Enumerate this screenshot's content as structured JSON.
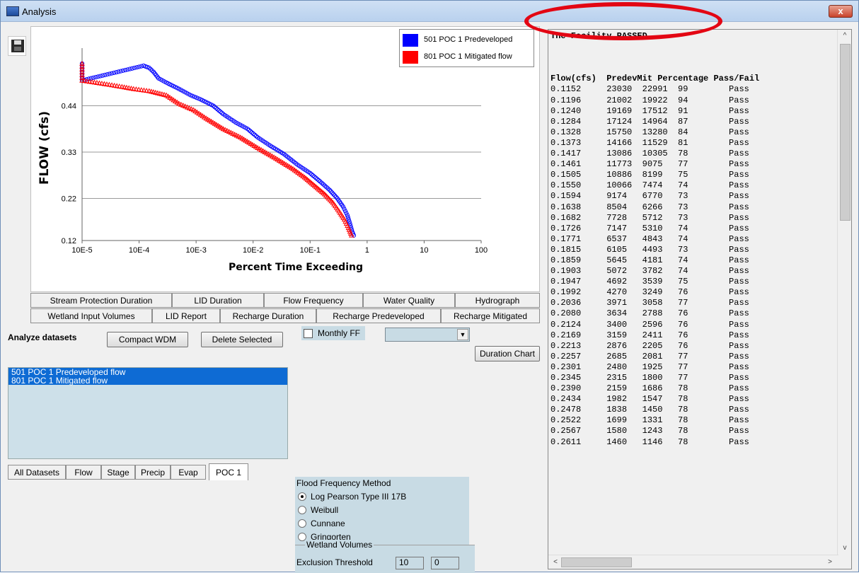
{
  "window": {
    "title": "Analysis",
    "close_label": "x"
  },
  "legend": [
    {
      "label": "501 POC 1 Predeveloped",
      "color": "#0000ff"
    },
    {
      "label": "801 POC 1 Mitigated flow",
      "color": "#ff0000"
    }
  ],
  "chart_data": {
    "type": "scatter",
    "title": "",
    "ylabel": "FLOW (cfs)",
    "xlabel": "Percent Time Exceeding",
    "x_scale": "log",
    "x_ticks": [
      "10E-5",
      "10E-4",
      "10E-3",
      "10E-2",
      "10E-1",
      "1",
      "10",
      "100"
    ],
    "y_ticks": [
      "0.12",
      "0.22",
      "0.33",
      "0.44"
    ],
    "ylim": [
      0.12,
      0.56
    ],
    "grid": "horizontal",
    "series": [
      {
        "name": "501 POC 1 Predeveloped",
        "color": "#0000ff",
        "marker": "circle",
        "points": [
          [
            1e-05,
            0.54
          ],
          [
            1e-05,
            0.52
          ],
          [
            1e-05,
            0.5
          ],
          [
            0.00012,
            0.535
          ],
          [
            0.00015,
            0.53
          ],
          [
            0.00018,
            0.52
          ],
          [
            0.00022,
            0.505
          ],
          [
            0.0003,
            0.495
          ],
          [
            0.0005,
            0.48
          ],
          [
            0.0008,
            0.465
          ],
          [
            0.0012,
            0.455
          ],
          [
            0.002,
            0.44
          ],
          [
            0.003,
            0.42
          ],
          [
            0.005,
            0.4
          ],
          [
            0.008,
            0.385
          ],
          [
            0.012,
            0.365
          ],
          [
            0.02,
            0.345
          ],
          [
            0.035,
            0.325
          ],
          [
            0.06,
            0.3
          ],
          [
            0.1,
            0.28
          ],
          [
            0.15,
            0.26
          ],
          [
            0.22,
            0.24
          ],
          [
            0.3,
            0.22
          ],
          [
            0.38,
            0.2
          ],
          [
            0.45,
            0.18
          ],
          [
            0.5,
            0.16
          ],
          [
            0.55,
            0.14
          ],
          [
            0.6,
            0.128
          ]
        ]
      },
      {
        "name": "801 POC 1 Mitigated flow",
        "color": "#ff0000",
        "marker": "triangle",
        "points": [
          [
            1e-05,
            0.54
          ],
          [
            1e-05,
            0.52
          ],
          [
            1e-05,
            0.5
          ],
          [
            3e-05,
            0.49
          ],
          [
            5e-05,
            0.485
          ],
          [
            8e-05,
            0.48
          ],
          [
            0.00015,
            0.475
          ],
          [
            0.0003,
            0.465
          ],
          [
            0.0005,
            0.445
          ],
          [
            0.0009,
            0.43
          ],
          [
            0.0015,
            0.41
          ],
          [
            0.003,
            0.385
          ],
          [
            0.006,
            0.365
          ],
          [
            0.012,
            0.34
          ],
          [
            0.025,
            0.315
          ],
          [
            0.05,
            0.29
          ],
          [
            0.08,
            0.27
          ],
          [
            0.12,
            0.25
          ],
          [
            0.18,
            0.23
          ],
          [
            0.25,
            0.21
          ],
          [
            0.32,
            0.19
          ],
          [
            0.4,
            0.17
          ],
          [
            0.47,
            0.15
          ],
          [
            0.55,
            0.128
          ]
        ]
      }
    ]
  },
  "tabs_row1": [
    "Stream Protection Duration",
    "LID Duration",
    "Flow Frequency",
    "Water Quality",
    "Hydrograph"
  ],
  "tabs_row2": [
    "Wetland Input Volumes",
    "LID Report",
    "Recharge Duration",
    "Recharge Predeveloped",
    "Recharge Mitigated"
  ],
  "analyze": {
    "label": "Analyze datasets",
    "compact": "Compact WDM",
    "delete": "Delete Selected"
  },
  "monthly_ff": "Monthly FF",
  "duration_chart": "Duration Chart",
  "datasets": [
    "501 POC 1 Predeveloped flow",
    "801 POC 1 Mitigated flow"
  ],
  "dataset_tabs": [
    "All Datasets",
    "Flow",
    "Stage",
    "Precip",
    "Evap",
    "POC 1"
  ],
  "flood_freq": {
    "title": "Flood Frequency Method",
    "options": [
      "Log Pearson Type III 17B",
      "Weibull",
      "Cunnane",
      "Gringorten"
    ],
    "selected": "Log Pearson Type III 17B"
  },
  "wetland": {
    "legend": "Wetland Volumes",
    "exclusion_label": "Exclusion Threshold",
    "value1": "10",
    "value2": "0"
  },
  "results": {
    "status": "The Facility PASSED",
    "header": [
      "Flow(cfs)",
      "Predev",
      "Mit",
      "Percentage",
      "Pass/Fail"
    ],
    "rows": [
      [
        "0.1152",
        "23030",
        "22991",
        "99",
        "Pass"
      ],
      [
        "0.1196",
        "21002",
        "19922",
        "94",
        "Pass"
      ],
      [
        "0.1240",
        "19169",
        "17512",
        "91",
        "Pass"
      ],
      [
        "0.1284",
        "17124",
        "14964",
        "87",
        "Pass"
      ],
      [
        "0.1328",
        "15750",
        "13280",
        "84",
        "Pass"
      ],
      [
        "0.1373",
        "14166",
        "11529",
        "81",
        "Pass"
      ],
      [
        "0.1417",
        "13086",
        "10305",
        "78",
        "Pass"
      ],
      [
        "0.1461",
        "11773",
        "9075",
        "77",
        "Pass"
      ],
      [
        "0.1505",
        "10886",
        "8199",
        "75",
        "Pass"
      ],
      [
        "0.1550",
        "10066",
        "7474",
        "74",
        "Pass"
      ],
      [
        "0.1594",
        "9174",
        "6770",
        "73",
        "Pass"
      ],
      [
        "0.1638",
        "8504",
        "6266",
        "73",
        "Pass"
      ],
      [
        "0.1682",
        "7728",
        "5712",
        "73",
        "Pass"
      ],
      [
        "0.1726",
        "7147",
        "5310",
        "74",
        "Pass"
      ],
      [
        "0.1771",
        "6537",
        "4843",
        "74",
        "Pass"
      ],
      [
        "0.1815",
        "6105",
        "4493",
        "73",
        "Pass"
      ],
      [
        "0.1859",
        "5645",
        "4181",
        "74",
        "Pass"
      ],
      [
        "0.1903",
        "5072",
        "3782",
        "74",
        "Pass"
      ],
      [
        "0.1947",
        "4692",
        "3539",
        "75",
        "Pass"
      ],
      [
        "0.1992",
        "4270",
        "3249",
        "76",
        "Pass"
      ],
      [
        "0.2036",
        "3971",
        "3058",
        "77",
        "Pass"
      ],
      [
        "0.2080",
        "3634",
        "2788",
        "76",
        "Pass"
      ],
      [
        "0.2124",
        "3400",
        "2596",
        "76",
        "Pass"
      ],
      [
        "0.2169",
        "3159",
        "2411",
        "76",
        "Pass"
      ],
      [
        "0.2213",
        "2876",
        "2205",
        "76",
        "Pass"
      ],
      [
        "0.2257",
        "2685",
        "2081",
        "77",
        "Pass"
      ],
      [
        "0.2301",
        "2480",
        "1925",
        "77",
        "Pass"
      ],
      [
        "0.2345",
        "2315",
        "1800",
        "77",
        "Pass"
      ],
      [
        "0.2390",
        "2159",
        "1686",
        "78",
        "Pass"
      ],
      [
        "0.2434",
        "1982",
        "1547",
        "78",
        "Pass"
      ],
      [
        "0.2478",
        "1838",
        "1450",
        "78",
        "Pass"
      ],
      [
        "0.2522",
        "1699",
        "1331",
        "78",
        "Pass"
      ],
      [
        "0.2567",
        "1580",
        "1243",
        "78",
        "Pass"
      ],
      [
        "0.2611",
        "1460",
        "1146",
        "78",
        "Pass"
      ]
    ]
  }
}
